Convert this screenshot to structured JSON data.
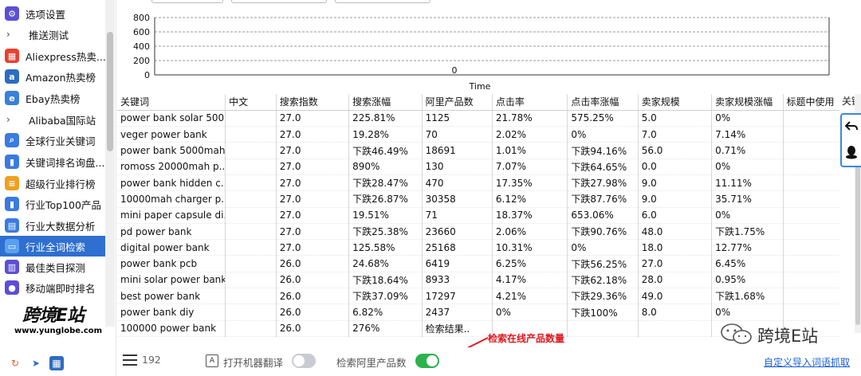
{
  "sidebar": {
    "items": [
      {
        "label": "选项设置",
        "icon": "settings-icon",
        "color": "#5b4fd6",
        "glyph": "⚙"
      },
      {
        "label": "推送测试",
        "icon": "chevron-right-icon",
        "color": "",
        "glyph": "›"
      },
      {
        "label": "Aliexpress热卖...",
        "icon": "shop-icon",
        "color": "#e8412f",
        "glyph": "▦"
      },
      {
        "label": "Amazon热卖榜",
        "icon": "amazon-icon",
        "color": "#2d6cc0",
        "glyph": "a"
      },
      {
        "label": "Ebay热卖榜",
        "icon": "ebay-icon",
        "color": "#3b7fd8",
        "glyph": "e"
      },
      {
        "label": "Alibaba国际站",
        "icon": "chevron-right-icon",
        "color": "",
        "glyph": "›"
      },
      {
        "label": "全球行业关键词",
        "icon": "search-icon",
        "color": "#3a7be0",
        "glyph": "⌕"
      },
      {
        "label": "关键词排名询盘...",
        "icon": "chart-icon",
        "color": "#3a7be0",
        "glyph": "▮"
      },
      {
        "label": "超级行业排行榜",
        "icon": "ranking-icon",
        "color": "#f0a020",
        "glyph": "≡"
      },
      {
        "label": "行业Top100产品",
        "icon": "bar-chart-icon",
        "color": "#3a7be0",
        "glyph": "▮"
      },
      {
        "label": "行业大数据分析",
        "icon": "analysis-icon",
        "color": "#3a7be0",
        "glyph": "▤"
      },
      {
        "label": "行业全词检索",
        "icon": "document-icon",
        "color": "#5aa0f0",
        "glyph": "▭"
      },
      {
        "label": "最佳类目探测",
        "icon": "target-icon",
        "color": "#5b4fd6",
        "glyph": "▥"
      },
      {
        "label": "移动端即时排名",
        "icon": "mobile-icon",
        "color": "#5b4fd6",
        "glyph": "●"
      }
    ],
    "active_index": 11,
    "logo_text": "跨境E站",
    "logo_url": "www.yunglobe.com"
  },
  "table": {
    "columns": [
      "关键词",
      "中文",
      "搜索指数",
      "搜索涨幅",
      "阿里产品数",
      "点击率",
      "点击率涨幅",
      "卖家规模",
      "卖家规模涨幅",
      "标题中使用"
    ],
    "extra_column": "关键",
    "rows": [
      [
        "power bank solar 500...",
        "",
        "27.0",
        "225.81%",
        "1125",
        "21.78%",
        "575.25%",
        "5.0",
        "0%",
        ""
      ],
      [
        "veger power bank",
        "",
        "27.0",
        "19.28%",
        "70",
        "2.02%",
        "0%",
        "7.0",
        "7.14%",
        ""
      ],
      [
        "power bank 5000mah",
        "",
        "27.0",
        "下跌46.49%",
        "18691",
        "1.01%",
        "下跌94.16%",
        "56.0",
        "0.71%",
        ""
      ],
      [
        "romoss 20000mah p...",
        "",
        "27.0",
        "890%",
        "130",
        "7.07%",
        "下跌64.65%",
        "0.0",
        "0%",
        ""
      ],
      [
        "power bank hidden c...",
        "",
        "27.0",
        "下跌28.47%",
        "470",
        "17.35%",
        "下跌27.98%",
        "9.0",
        "11.11%",
        ""
      ],
      [
        "10000mah charger p...",
        "",
        "27.0",
        "下跌26.87%",
        "30358",
        "6.12%",
        "下跌87.76%",
        "9.0",
        "35.71%",
        ""
      ],
      [
        "mini paper capsule di...",
        "",
        "27.0",
        "19.51%",
        "71",
        "18.37%",
        "653.06%",
        "6.0",
        "0%",
        ""
      ],
      [
        "pd power bank",
        "",
        "27.0",
        "下跌25.38%",
        "23660",
        "2.06%",
        "下跌90.76%",
        "48.0",
        "下跌1.75%",
        ""
      ],
      [
        "digital power bank",
        "",
        "27.0",
        "125.58%",
        "25168",
        "10.31%",
        "0%",
        "18.0",
        "12.77%",
        ""
      ],
      [
        "power bank pcb",
        "",
        "26.0",
        "24.68%",
        "6419",
        "6.25%",
        "下跌56.25%",
        "27.0",
        "6.45%",
        ""
      ],
      [
        "mini solar power bank",
        "",
        "26.0",
        "下跌18.64%",
        "8933",
        "4.17%",
        "下跌62.18%",
        "28.0",
        "0.95%",
        ""
      ],
      [
        "best power bank",
        "",
        "26.0",
        "下跌37.09%",
        "17297",
        "4.21%",
        "下跌29.36%",
        "49.0",
        "下跌1.68%",
        ""
      ],
      [
        "power bank diy",
        "",
        "26.0",
        "6.82%",
        "2437",
        "0%",
        "下跌100%",
        "8.0",
        "0%",
        ""
      ],
      [
        "100000 power bank",
        "",
        "26.0",
        "276%",
        "检索结果..",
        "",
        "",
        "",
        "",
        ""
      ]
    ]
  },
  "footer": {
    "row_count": "192",
    "translate_label": "打开机器翻译",
    "translate_on": false,
    "ali_count_label": "检索阿里产品数",
    "ali_count_on": true,
    "custom_link": "自定义导入词语抓取"
  },
  "annotation": {
    "text": "检索在线产品数量",
    "color": "#e0161e"
  },
  "watermark": {
    "text": "跨境E站"
  },
  "chart_data": {
    "type": "line",
    "x": [],
    "series": [],
    "yticks": [
      "800",
      "600",
      "400",
      "200",
      "0"
    ],
    "ylim": [
      0,
      800
    ],
    "xlabel": "Time",
    "center_label": "0",
    "grid": true
  },
  "colors": {
    "active": "#2f6fd0",
    "toggle_on": "#2bb24c",
    "toggle_off": "#c8cbd2",
    "link": "#1a5fd6"
  }
}
